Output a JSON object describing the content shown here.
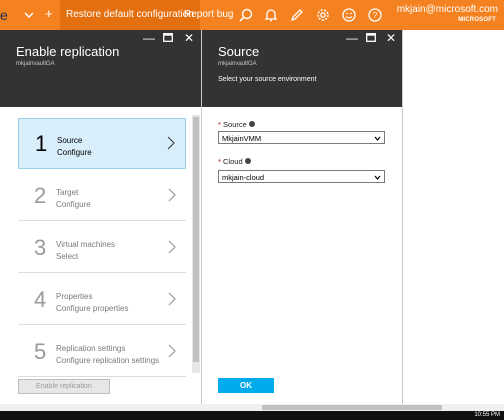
{
  "topbar": {
    "brand_fragment": "e",
    "restore_label": "Restore default configuration",
    "report_label": "Report bug",
    "user_email": "mkjain@microsoft.com",
    "user_org": "MICROSOFT",
    "icons": [
      "chevron-down-icon",
      "plus-icon",
      "search-icon",
      "bell-icon",
      "edit-icon",
      "gear-icon",
      "smiley-icon",
      "help-icon"
    ]
  },
  "left_blade": {
    "title": "Enable replication",
    "subtitle": "mkjainvaultGA",
    "steps": [
      {
        "num": "1",
        "title": "Source",
        "sub": "Configure",
        "active": true
      },
      {
        "num": "2",
        "title": "Target",
        "sub": "Configure",
        "active": false
      },
      {
        "num": "3",
        "title": "Virtual machines",
        "sub": "Select",
        "active": false
      },
      {
        "num": "4",
        "title": "Properties",
        "sub": "Configure properties",
        "active": false
      },
      {
        "num": "5",
        "title": "Replication settings",
        "sub": "Configure replication settings",
        "active": false
      }
    ],
    "enable_button": "Enable replication"
  },
  "right_blade": {
    "title": "Source",
    "subtitle": "mkjainvaultGA",
    "description": "Select your source environment",
    "source_label": "Source",
    "source_value": "MkjainVMM",
    "cloud_label": "Cloud",
    "cloud_value": "mkjain-cloud",
    "ok_button": "OK"
  },
  "taskbar": {
    "clock": "10:55 PM"
  },
  "colors": {
    "accent": "#f58220",
    "blade_header": "#333333",
    "active_step": "#d8eefa",
    "ok_button": "#00abec"
  }
}
